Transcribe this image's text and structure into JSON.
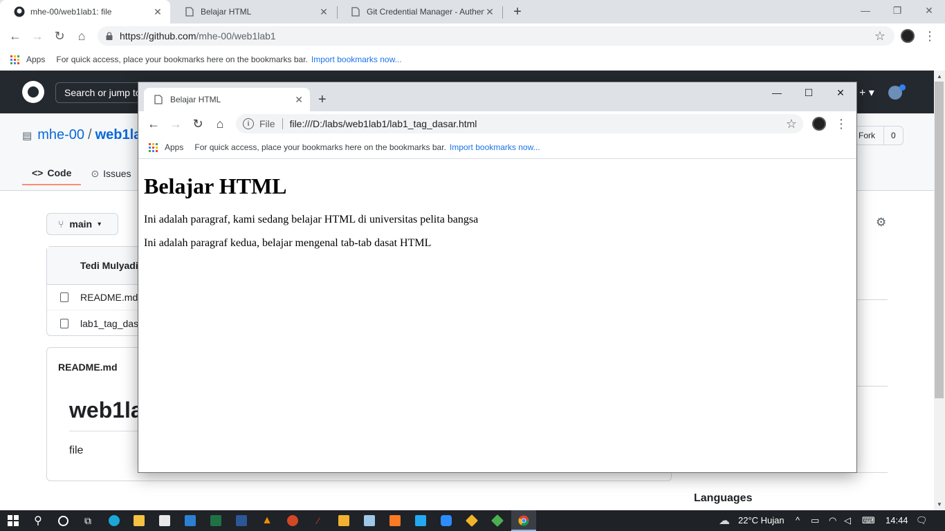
{
  "main_window": {
    "tabs": [
      {
        "title": "mhe-00/web1lab1: file",
        "icon": "github-icon",
        "active": true
      },
      {
        "title": "Belajar HTML",
        "icon": "page-icon",
        "active": false
      },
      {
        "title": "Git Credential Manager - Authen",
        "icon": "page-icon",
        "active": false
      }
    ],
    "url_host": "https://github.com",
    "url_path": "/mhe-00/web1lab1",
    "bookmarks": {
      "apps_label": "Apps",
      "hint": "For quick access, place your bookmarks here on the bookmarks bar.",
      "import_link": "Import bookmarks now..."
    }
  },
  "github": {
    "search_placeholder": "Search or jump to...",
    "owner": "mhe-00",
    "separator": "/",
    "repo": "web1lab1",
    "tabs": {
      "code": "Code",
      "issues": "Issues"
    },
    "fork_label": "Fork",
    "fork_count": "0",
    "branch": "main",
    "commit_author": "Tedi Mulyadi",
    "files": [
      "README.md",
      "lab1_tag_dasar.html"
    ],
    "readme_title": "README.md",
    "readme_heading": "web1lab1",
    "readme_text": "file",
    "languages_label": "Languages"
  },
  "popup_window": {
    "tab_title": "Belajar HTML",
    "file_label": "File",
    "url": "file:///D:/labs/web1lab1/lab1_tag_dasar.html",
    "bookmarks": {
      "apps_label": "Apps",
      "hint": "For quick access, place your bookmarks here on the bookmarks bar.",
      "import_link": "Import bookmarks now..."
    },
    "page": {
      "heading": "Belajar HTML",
      "paragraphs": [
        "Ini adalah paragraf, kami sedang belajar HTML di universitas pelita bangsa",
        "Ini adalah paragraf kedua, belajar mengenal tab-tab dasat HTML"
      ]
    }
  },
  "taskbar": {
    "weather": "22°C  Hujan",
    "time": "14:44"
  },
  "colors": {
    "github_header": "#24292f",
    "link_blue": "#0969da",
    "chrome_strip": "#dee1e6",
    "taskbar": "#1f2226"
  }
}
